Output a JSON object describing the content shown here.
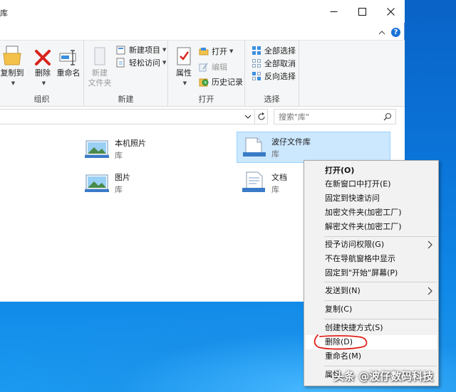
{
  "window": {
    "title_fragment": "库"
  },
  "ribbon": {
    "organize": {
      "label": "组织",
      "copy_to": "复制到",
      "delete": "删除",
      "rename": "重命名"
    },
    "new": {
      "label": "新建",
      "new_item": "新建项目",
      "easy_access": "轻松访问",
      "new_folder_line1": "新建",
      "new_folder_line2": "文件夹"
    },
    "open": {
      "label": "打开",
      "properties": "属性",
      "open": "打开",
      "edit": "编辑",
      "history": "历史记录"
    },
    "select": {
      "label": "选择",
      "select_all": "全部选择",
      "select_none": "全部取消",
      "invert": "反向选择"
    }
  },
  "navbar": {
    "search_placeholder": "搜索\"库\""
  },
  "libraries": [
    {
      "name": "本机照片",
      "type": "库"
    },
    {
      "name": "波仔文件库",
      "type": "库"
    },
    {
      "name": "图片",
      "type": "库"
    },
    {
      "name": "文档",
      "type": "库"
    }
  ],
  "context_menu": {
    "items": [
      {
        "label": "打开(O)",
        "bold": true
      },
      {
        "label": "在新窗口中打开(E)"
      },
      {
        "label": "固定到快速访问"
      },
      {
        "label": "加密文件夹(加密工厂)"
      },
      {
        "label": "解密文件夹(加密工厂)"
      },
      {
        "label": "授予访问权限(G)",
        "submenu": true
      },
      {
        "label": "不在导航窗格中显示"
      },
      {
        "label": "固定到\"开始\"屏幕(P)"
      },
      {
        "label": "发送到(N)",
        "submenu": true
      },
      {
        "label": "复制(C)"
      },
      {
        "label": "创建快捷方式(S)"
      },
      {
        "label": "删除(D)",
        "highlighted": true
      },
      {
        "label": "重命名(M)"
      },
      {
        "label": "属性"
      }
    ]
  },
  "watermark": "头条 @波仔数码科技",
  "colors": {
    "accent": "#1a73d9",
    "selection": "#cce8ff",
    "annotation": "#e0201a"
  }
}
